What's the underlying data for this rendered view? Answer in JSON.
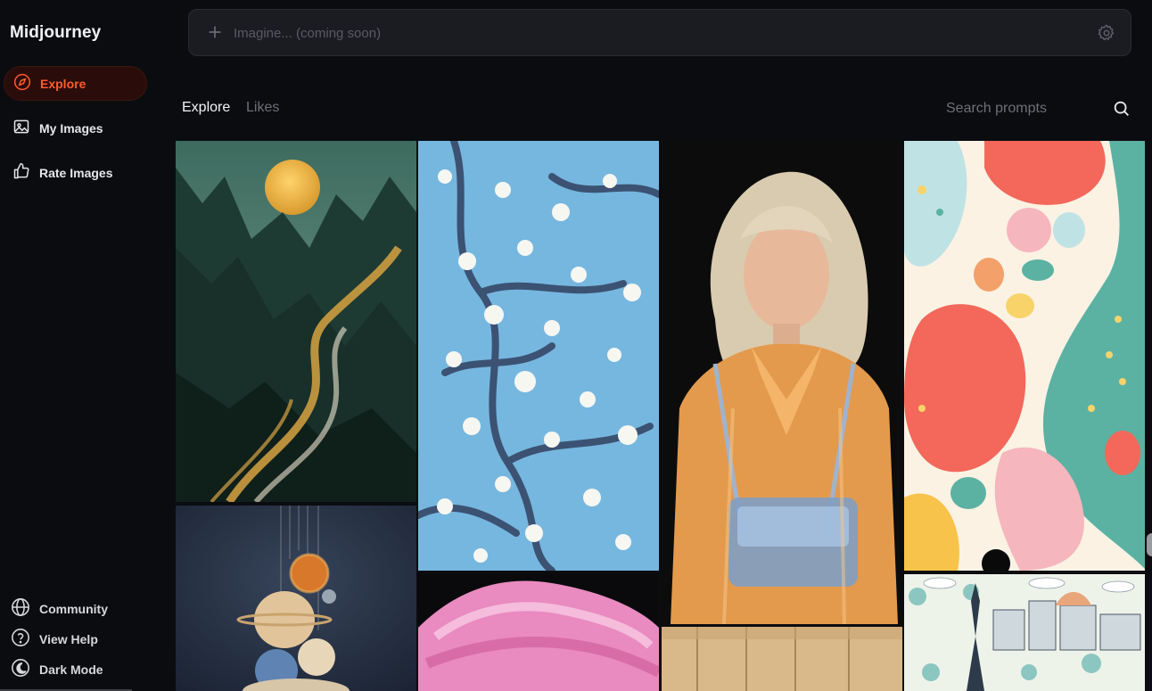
{
  "sidebar": {
    "brand": "Midjourney",
    "nav": [
      {
        "label": "Explore",
        "icon": "compass-icon",
        "active": true
      },
      {
        "label": "My Images",
        "icon": "image-icon",
        "active": false
      },
      {
        "label": "Rate Images",
        "icon": "thumbs-up-icon",
        "active": false
      }
    ],
    "bottom": [
      {
        "label": "Community",
        "icon": "globe-icon"
      },
      {
        "label": "View Help",
        "icon": "help-icon"
      },
      {
        "label": "Dark Mode",
        "icon": "moon-icon"
      }
    ]
  },
  "prompt": {
    "placeholder": "Imagine... (coming soon)",
    "plus_icon": "plus-icon",
    "settings_icon": "settings-icon"
  },
  "tabs": [
    {
      "label": "Explore",
      "active": true
    },
    {
      "label": "Likes",
      "active": false
    }
  ],
  "search": {
    "placeholder": "Search prompts",
    "icon": "search-icon"
  },
  "gallery": [
    {
      "name": "mountain-river-image"
    },
    {
      "name": "cherry-blossom-image"
    },
    {
      "name": "blonde-woman-raincoat-image"
    },
    {
      "name": "abstract-shapes-image"
    },
    {
      "name": "planets-mobile-image"
    },
    {
      "name": "pink-hair-image"
    },
    {
      "name": "wood-planks-image"
    },
    {
      "name": "paris-pattern-image"
    }
  ],
  "colors": {
    "accent": "#ff5a2c",
    "background": "#0b0c10",
    "prompt_bg": "#1b1c21"
  }
}
